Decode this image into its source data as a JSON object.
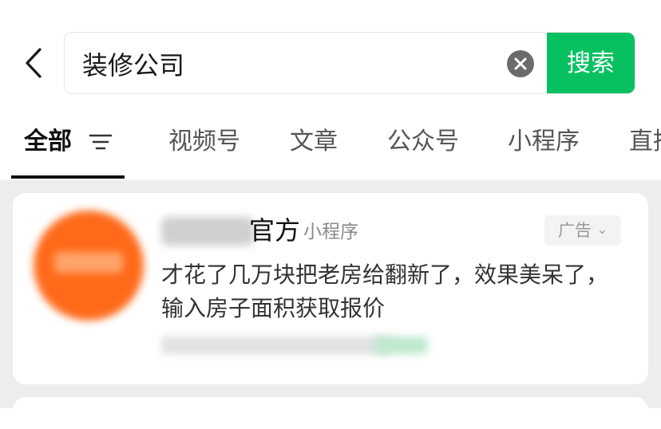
{
  "colors": {
    "accent": "#07c160",
    "background": "#ededed"
  },
  "header": {
    "back_icon": "chevron-left-icon",
    "search": {
      "value": "装修公司",
      "clear_icon": "clear-circle-icon",
      "button_label": "搜索"
    }
  },
  "tabs": {
    "items": [
      {
        "label": "全部",
        "active": true
      },
      {
        "label": "视频号"
      },
      {
        "label": "文章"
      },
      {
        "label": "公众号"
      },
      {
        "label": "小程序"
      },
      {
        "label": "直播"
      }
    ],
    "filter_icon": "filter-icon"
  },
  "result": {
    "name_visible": "官方",
    "type": "小程序",
    "ad_label": "广告",
    "ad_chevron": "⌄",
    "description": "才花了几万块把老房给翻新了，效果美呆了，输入房子面积获取报价"
  }
}
